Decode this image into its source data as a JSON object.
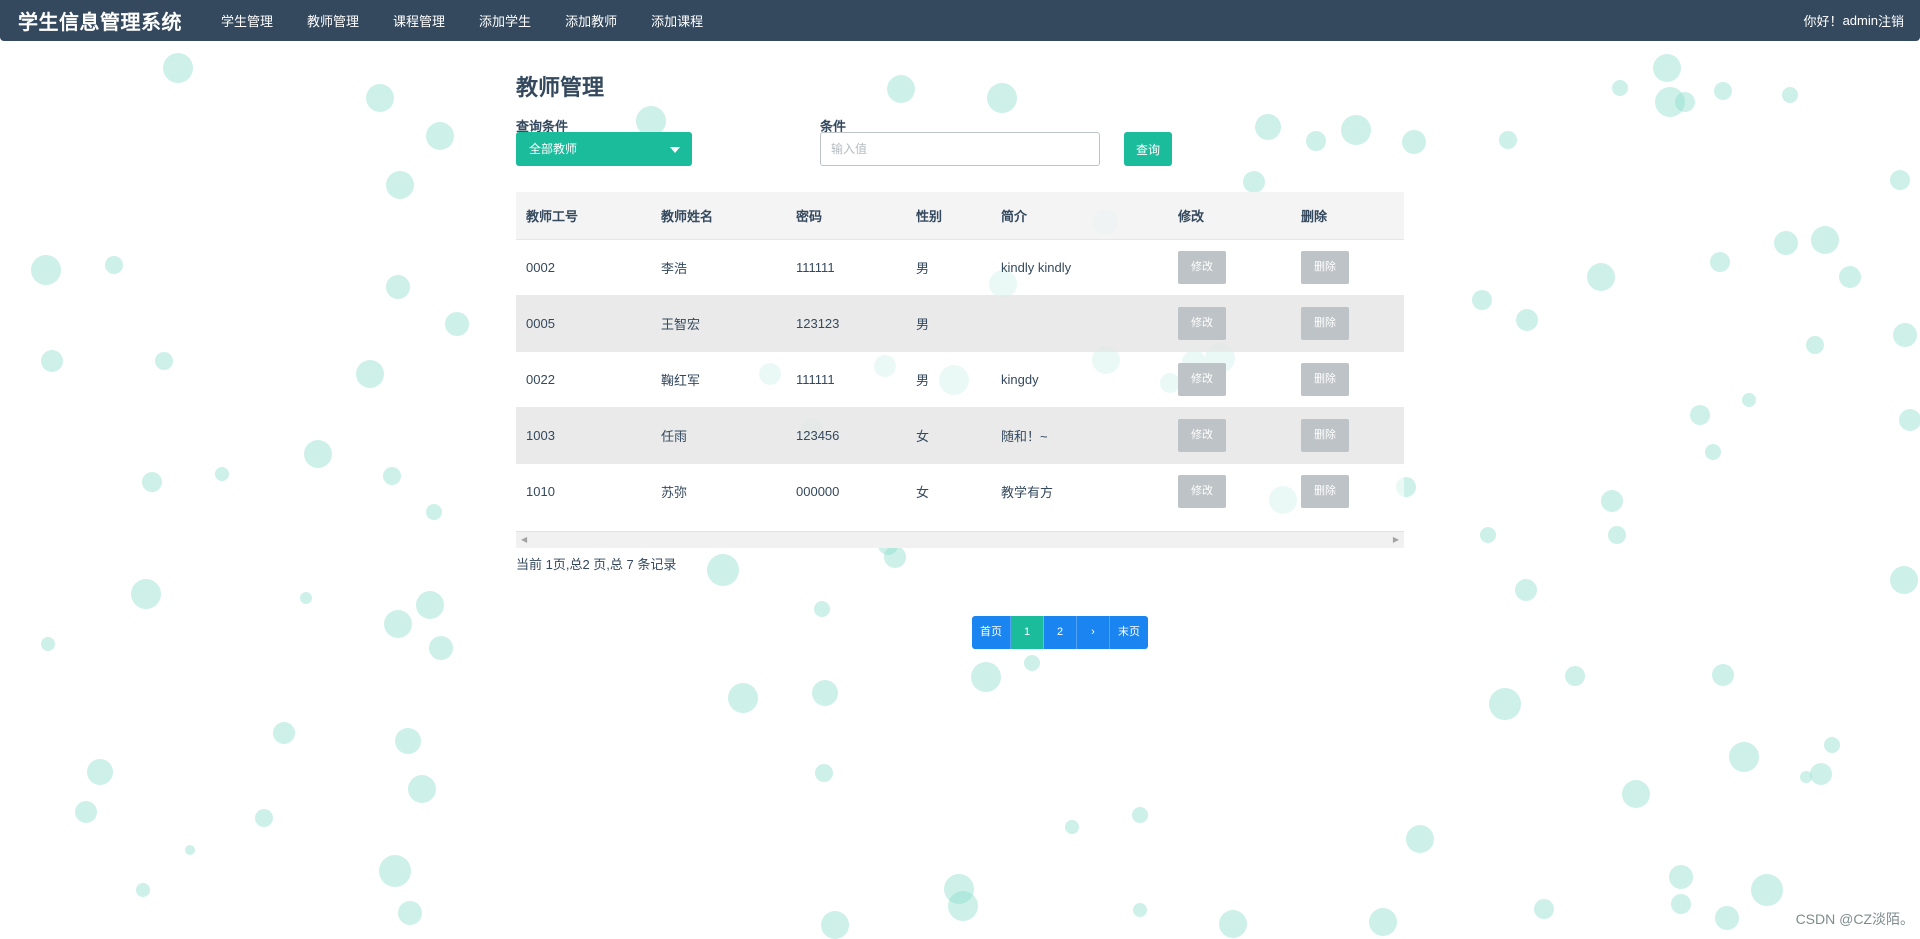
{
  "navbar": {
    "brand": "学生信息管理系统",
    "links": [
      "学生管理",
      "教师管理",
      "课程管理",
      "添加学生",
      "添加教师",
      "添加课程"
    ],
    "greeting": "你好！",
    "user": "admin",
    "logout": "注销"
  },
  "page": {
    "title": "教师管理",
    "query_label": "查询条件",
    "query_select_value": "全部教师",
    "condition_label": "条件",
    "condition_placeholder": "输入值",
    "search_button": "查询"
  },
  "table": {
    "headers": [
      "教师工号",
      "教师姓名",
      "密码",
      "性别",
      "简介",
      "修改",
      "删除"
    ],
    "rows": [
      {
        "id": "0002",
        "name": "李浩",
        "password": "111111",
        "gender": "男",
        "intro": "kindly kindly",
        "edit": "修改",
        "delete": "删除"
      },
      {
        "id": "0005",
        "name": "王智宏",
        "password": "123123",
        "gender": "男",
        "intro": "",
        "edit": "修改",
        "delete": "删除"
      },
      {
        "id": "0022",
        "name": "鞠红军",
        "password": "111111",
        "gender": "男",
        "intro": "kingdy",
        "edit": "修改",
        "delete": "删除"
      },
      {
        "id": "1003",
        "name": "任雨",
        "password": "123456",
        "gender": "女",
        "intro": "随和！~",
        "edit": "修改",
        "delete": "删除"
      },
      {
        "id": "1010",
        "name": "苏弥",
        "password": "000000",
        "gender": "女",
        "intro": "教学有方",
        "edit": "修改",
        "delete": "删除"
      }
    ]
  },
  "summary": "当前 1页,总2 页,总 7 条记录",
  "pagination": {
    "first": "首页",
    "pages": [
      "1",
      "2"
    ],
    "active_page": "1",
    "next": "›",
    "last": "末页"
  },
  "watermark": "CSDN @CZ淡陌。",
  "colors": {
    "navbar": "#34495e",
    "accent": "#1abc9c",
    "pager": "#1a85f0",
    "table_button": "#bdc3c7",
    "bubble": "#90dece"
  }
}
